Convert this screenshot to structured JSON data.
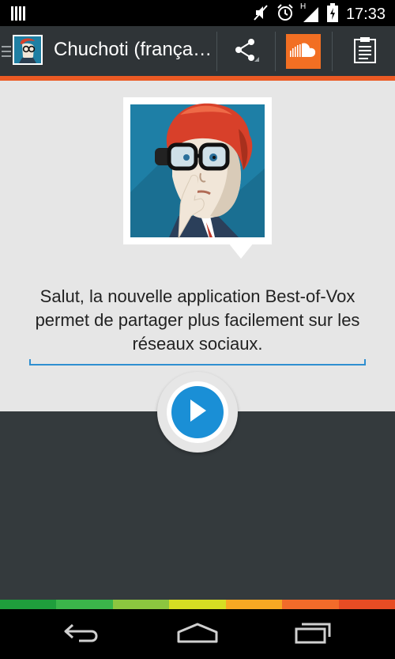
{
  "status_bar": {
    "time": "17:33",
    "network_type": "H",
    "icons": [
      "notification-bars-icon",
      "mute-icon",
      "alarm-icon",
      "signal-icon",
      "battery-charging-icon"
    ]
  },
  "action_bar": {
    "title": "Chuchoti (frança…",
    "accent_color": "#ec5a24",
    "actions": [
      "share-icon",
      "soundcloud-icon",
      "clipboard-icon"
    ]
  },
  "main": {
    "message": "Salut, la nouvelle application Best-of-Vox permet de partager plus facilement sur les réseaux sociaux.",
    "play_color": "#1a8fd6"
  },
  "level_strip": {
    "colors": [
      "#1f9e3c",
      "#3bb54a",
      "#8cc63f",
      "#d6de23",
      "#f7a823",
      "#f26b2a",
      "#e74c24"
    ]
  },
  "nav_bar": {
    "buttons": [
      "back-icon",
      "home-icon",
      "recent-apps-icon"
    ]
  }
}
